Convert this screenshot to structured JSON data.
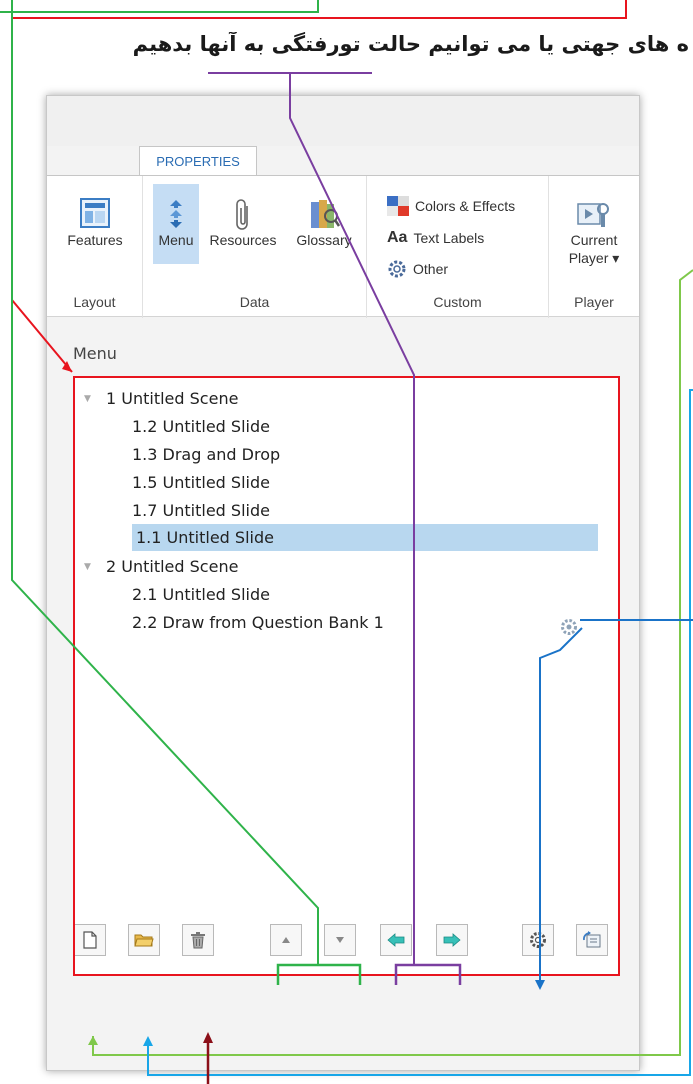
{
  "caption": "ه های جهتی یا می توانیم حالت تورفتگی به آنها بدهیم",
  "colors": {
    "annotation_red": "#e8141e",
    "annotation_green": "#2fb34a",
    "annotation_purple": "#7a3ea0",
    "annotation_blue": "#1a73c8",
    "annotation_cyan": "#18a6e8",
    "annotation_darkred": "#8b0f18",
    "selection": "#b8d7ef",
    "tab_text": "#2a6cb3"
  },
  "ribbon": {
    "tab_label": "PROPERTIES",
    "groups": {
      "layout": {
        "label": "Layout",
        "buttons": [
          {
            "label": "Features",
            "icon": "features-icon"
          }
        ]
      },
      "data": {
        "label": "Data",
        "buttons": [
          {
            "label": "Menu",
            "icon": "menu-icon",
            "selected": true
          },
          {
            "label": "Resources",
            "icon": "paperclip-icon"
          },
          {
            "label": "Glossary",
            "icon": "glossary-book-icon"
          }
        ]
      },
      "custom": {
        "label": "Custom",
        "buttons": [
          {
            "label": "Colors & Effects",
            "icon": "colors-effects-icon"
          },
          {
            "label": "Text Labels",
            "icon": "text-labels-icon",
            "prefix": "Aa"
          },
          {
            "label": "Other",
            "icon": "gear-icon"
          }
        ]
      },
      "player": {
        "label": "Player",
        "buttons": [
          {
            "label_line1": "Current",
            "label_line2": "Player ▾",
            "icon": "current-player-icon"
          }
        ]
      }
    }
  },
  "menu": {
    "title": "Menu",
    "items": [
      {
        "label": "1 Untitled Scene",
        "level": 0,
        "expanded": true
      },
      {
        "label": "1.2 Untitled Slide",
        "level": 1
      },
      {
        "label": "1.3 Drag and Drop",
        "level": 1
      },
      {
        "label": "1.5 Untitled Slide",
        "level": 1
      },
      {
        "label": "1.7 Untitled Slide",
        "level": 1
      },
      {
        "label": "1.1 Untitled Slide",
        "level": 1,
        "selected": true
      },
      {
        "label": "2 Untitled Scene",
        "level": 0,
        "expanded": true
      },
      {
        "label": "2.1 Untitled Slide",
        "level": 1
      },
      {
        "label": "2.2 Draw from Question Bank 1",
        "level": 1,
        "has_gear": true
      }
    ]
  },
  "toolbar": [
    {
      "name": "new-item",
      "icon": "new-page-icon"
    },
    {
      "name": "open-folder",
      "icon": "folder-icon"
    },
    {
      "name": "delete",
      "icon": "trash-icon"
    },
    {
      "name": "move-up",
      "icon": "triangle-up-icon"
    },
    {
      "name": "move-down",
      "icon": "triangle-down-icon"
    },
    {
      "name": "outdent",
      "icon": "arrow-left-icon"
    },
    {
      "name": "indent",
      "icon": "arrow-right-icon"
    },
    {
      "name": "settings",
      "icon": "gear-icon"
    },
    {
      "name": "reset",
      "icon": "reset-icon"
    }
  ]
}
